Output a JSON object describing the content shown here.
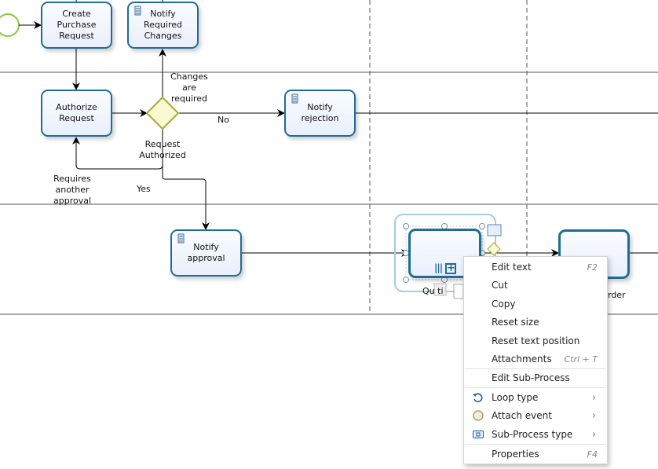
{
  "diagram": {
    "tasks": [
      {
        "id": "create",
        "label": "Create Purchase Request",
        "doc": false
      },
      {
        "id": "notify_changes",
        "label": "Notify Required Changes",
        "doc": true
      },
      {
        "id": "authorize",
        "label": "Authorize Request",
        "doc": false
      },
      {
        "id": "notify_rejection",
        "label": "Notify rejection",
        "doc": true
      },
      {
        "id": "notify_approval",
        "label": "Notify approval",
        "doc": true
      },
      {
        "id": "subprocess",
        "label": "",
        "doc": false
      },
      {
        "id": "order",
        "label": "",
        "doc": false
      }
    ],
    "labels": {
      "changes_required": "Changes are required",
      "no": "No",
      "request_authorized": "Request Authorized",
      "requires_another": "Requires another approval",
      "yes": "Yes",
      "subprocess_name_partial": "Qu ti",
      "order_name_partial": "rder"
    },
    "colors": {
      "task_border": "#1f6d96",
      "gateway_fill": "#fafad2",
      "gateway_border": "#a8a83a",
      "start_event": "#8cc63f",
      "selection": "#a7cbe0"
    }
  },
  "context_menu": {
    "items": [
      {
        "label": "Edit text",
        "shortcut": "F2",
        "icon": "",
        "submenu": false
      },
      {
        "label": "Cut",
        "shortcut": "",
        "icon": "",
        "submenu": false
      },
      {
        "label": "Copy",
        "shortcut": "",
        "icon": "",
        "submenu": false
      },
      {
        "label": "Reset size",
        "shortcut": "",
        "icon": "",
        "submenu": false
      },
      {
        "label": "Reset text position",
        "shortcut": "",
        "icon": "",
        "submenu": false
      },
      {
        "label": "Attachments",
        "shortcut": "Ctrl + T",
        "icon": "",
        "submenu": false
      },
      {
        "label": "Edit Sub-Process",
        "shortcut": "",
        "icon": "",
        "submenu": false
      },
      {
        "label": "Loop type",
        "shortcut": "",
        "icon": "loop-icon",
        "submenu": true
      },
      {
        "label": "Attach event",
        "shortcut": "",
        "icon": "event-circle-icon",
        "submenu": true
      },
      {
        "label": "Sub-Process type",
        "shortcut": "",
        "icon": "subprocess-type-icon",
        "submenu": true
      },
      {
        "label": "Properties",
        "shortcut": "F4",
        "icon": "",
        "submenu": false
      }
    ]
  }
}
